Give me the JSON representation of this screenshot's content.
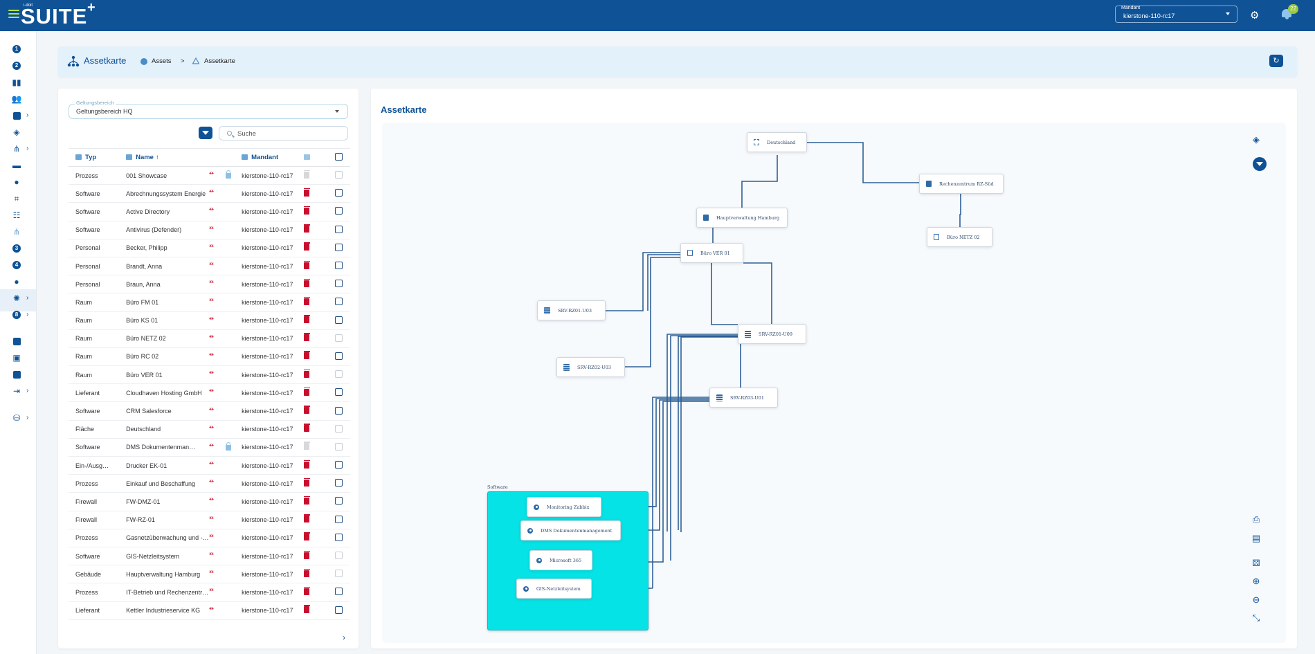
{
  "app": {
    "logo_text": "SUITE",
    "logo_prefix": "i-doit",
    "notification_count": "22"
  },
  "mandant": {
    "label": "Mandant",
    "value": "kierstone-110-rc17"
  },
  "nav": {
    "items": [
      "1",
      "2",
      "3",
      "4",
      "8"
    ]
  },
  "header": {
    "title": "Assetkarte",
    "breadcrumb": [
      "Assets",
      "Assetkarte"
    ],
    "separator": ">"
  },
  "scope": {
    "label": "Geltungsbereich",
    "value": "Geltungsbereich HQ"
  },
  "search": {
    "placeholder": "Suche"
  },
  "table": {
    "headers": {
      "typ": "Typ",
      "name": "Name",
      "sort": "↑",
      "mandant": "Mandant"
    },
    "rows": [
      {
        "typ": "Prozess",
        "name": "001 Showcase",
        "mandant": "kierstone-110-rc17",
        "locked": true,
        "deletable": false,
        "chk_dim": true
      },
      {
        "typ": "Software",
        "name": "Abrechnungssystem Energie",
        "mandant": "kierstone-110-rc17",
        "locked": false,
        "deletable": true,
        "chk_dim": false
      },
      {
        "typ": "Software",
        "name": "Active Directory",
        "mandant": "kierstone-110-rc17",
        "locked": false,
        "deletable": true,
        "chk_dim": false
      },
      {
        "typ": "Software",
        "name": "Antivirus (Defender)",
        "mandant": "kierstone-110-rc17",
        "locked": false,
        "deletable": true,
        "chk_dim": false
      },
      {
        "typ": "Personal",
        "name": "Becker, Philipp",
        "mandant": "kierstone-110-rc17",
        "locked": false,
        "deletable": true,
        "chk_dim": false
      },
      {
        "typ": "Personal",
        "name": "Brandt, Anna",
        "mandant": "kierstone-110-rc17",
        "locked": false,
        "deletable": true,
        "chk_dim": false
      },
      {
        "typ": "Personal",
        "name": "Braun, Anna",
        "mandant": "kierstone-110-rc17",
        "locked": false,
        "deletable": true,
        "chk_dim": false
      },
      {
        "typ": "Raum",
        "name": "Büro FM 01",
        "mandant": "kierstone-110-rc17",
        "locked": false,
        "deletable": true,
        "chk_dim": false
      },
      {
        "typ": "Raum",
        "name": "Büro KS 01",
        "mandant": "kierstone-110-rc17",
        "locked": false,
        "deletable": true,
        "chk_dim": false
      },
      {
        "typ": "Raum",
        "name": "Büro NETZ 02",
        "mandant": "kierstone-110-rc17",
        "locked": false,
        "deletable": true,
        "chk_dim": true
      },
      {
        "typ": "Raum",
        "name": "Büro RC 02",
        "mandant": "kierstone-110-rc17",
        "locked": false,
        "deletable": true,
        "chk_dim": false
      },
      {
        "typ": "Raum",
        "name": "Büro VER 01",
        "mandant": "kierstone-110-rc17",
        "locked": false,
        "deletable": true,
        "chk_dim": true
      },
      {
        "typ": "Lieferant",
        "name": "Cloudhaven Hosting GmbH",
        "mandant": "kierstone-110-rc17",
        "locked": false,
        "deletable": true,
        "chk_dim": false
      },
      {
        "typ": "Software",
        "name": "CRM Salesforce",
        "mandant": "kierstone-110-rc17",
        "locked": false,
        "deletable": true,
        "chk_dim": false
      },
      {
        "typ": "Fläche",
        "name": "Deutschland",
        "mandant": "kierstone-110-rc17",
        "locked": false,
        "deletable": true,
        "chk_dim": true
      },
      {
        "typ": "Software",
        "name": "DMS Dokumentenman…",
        "mandant": "kierstone-110-rc17",
        "locked": true,
        "deletable": false,
        "chk_dim": true
      },
      {
        "typ": "Ein-/Ausg…",
        "name": "Drucker EK-01",
        "mandant": "kierstone-110-rc17",
        "locked": false,
        "deletable": true,
        "chk_dim": false
      },
      {
        "typ": "Prozess",
        "name": "Einkauf und Beschaffung",
        "mandant": "kierstone-110-rc17",
        "locked": false,
        "deletable": true,
        "chk_dim": false
      },
      {
        "typ": "Firewall",
        "name": "FW-DMZ-01",
        "mandant": "kierstone-110-rc17",
        "locked": false,
        "deletable": true,
        "chk_dim": false
      },
      {
        "typ": "Firewall",
        "name": "FW-RZ-01",
        "mandant": "kierstone-110-rc17",
        "locked": false,
        "deletable": true,
        "chk_dim": false
      },
      {
        "typ": "Prozess",
        "name": "Gasnetzüberwachung und -…",
        "mandant": "kierstone-110-rc17",
        "locked": false,
        "deletable": true,
        "chk_dim": false
      },
      {
        "typ": "Software",
        "name": "GIS-Netzleitsystem",
        "mandant": "kierstone-110-rc17",
        "locked": false,
        "deletable": true,
        "chk_dim": true
      },
      {
        "typ": "Gebäude",
        "name": "Hauptverwaltung Hamburg",
        "mandant": "kierstone-110-rc17",
        "locked": false,
        "deletable": true,
        "chk_dim": true
      },
      {
        "typ": "Prozess",
        "name": "IT-Betrieb und Rechenzentr…",
        "mandant": "kierstone-110-rc17",
        "locked": false,
        "deletable": true,
        "chk_dim": false
      },
      {
        "typ": "Lieferant",
        "name": "Kettler Industrieservice KG",
        "mandant": "kierstone-110-rc17",
        "locked": false,
        "deletable": true,
        "chk_dim": false
      }
    ]
  },
  "map": {
    "title": "Assetkarte",
    "group_label": "Software",
    "nodes": {
      "deutschland": "Deutschland",
      "rz_sued": "Rechenzentrum RZ-Süd",
      "hv_hamburg": "Hauptverwaltung Hamburg",
      "buero_netz": "Büro NETZ 02",
      "buero_ver": "Büro VER 01",
      "srv1": "SRV-RZ01-U03",
      "srv2": "SRV-RZ01-U09",
      "srv3": "SRV-RZ02-U03",
      "srv4": "SRV-RZ03-U01",
      "sw1": "Monitoring Zabbix",
      "sw2": "DMS Dokumentenmanagement",
      "sw3": "Microsoft 365",
      "sw4": "GIS-Netzleitsystem"
    }
  },
  "colors": {
    "primary": "#0f5296",
    "accent": "#9ac93c",
    "danger": "#c8102e",
    "group_fill": "#05e3e6"
  }
}
